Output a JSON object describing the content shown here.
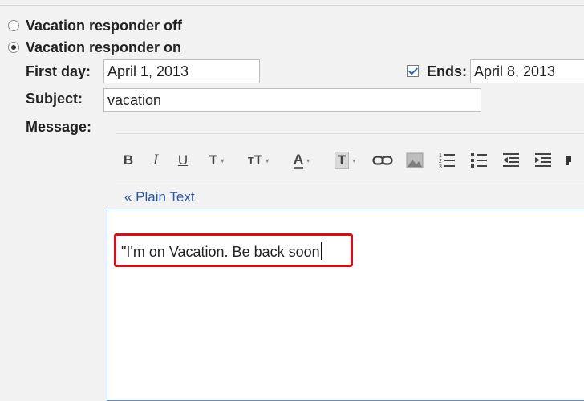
{
  "responder": {
    "off_label": "Vacation responder off",
    "on_label": "Vacation responder on",
    "selected": "on"
  },
  "first_day": {
    "label": "First day:",
    "value": "April 1, 2013"
  },
  "ends": {
    "label": "Ends:",
    "checked": true,
    "value": "April 8, 2013"
  },
  "subject": {
    "label": "Subject:",
    "value": "vacation"
  },
  "message": {
    "label": "Message:",
    "plain_text_link": "« Plain Text",
    "body": "\"I'm on Vacation. Be back soon"
  },
  "toolbar": {
    "bold": "B",
    "italic": "I",
    "underline": "U",
    "font": "T",
    "size": "ᵀT",
    "text_color": "A",
    "bg_color": "T",
    "caret": "▾"
  },
  "colors": {
    "highlight": "#d0101a",
    "link": "#2a56a8",
    "editor_border": "#5a8ad0"
  }
}
